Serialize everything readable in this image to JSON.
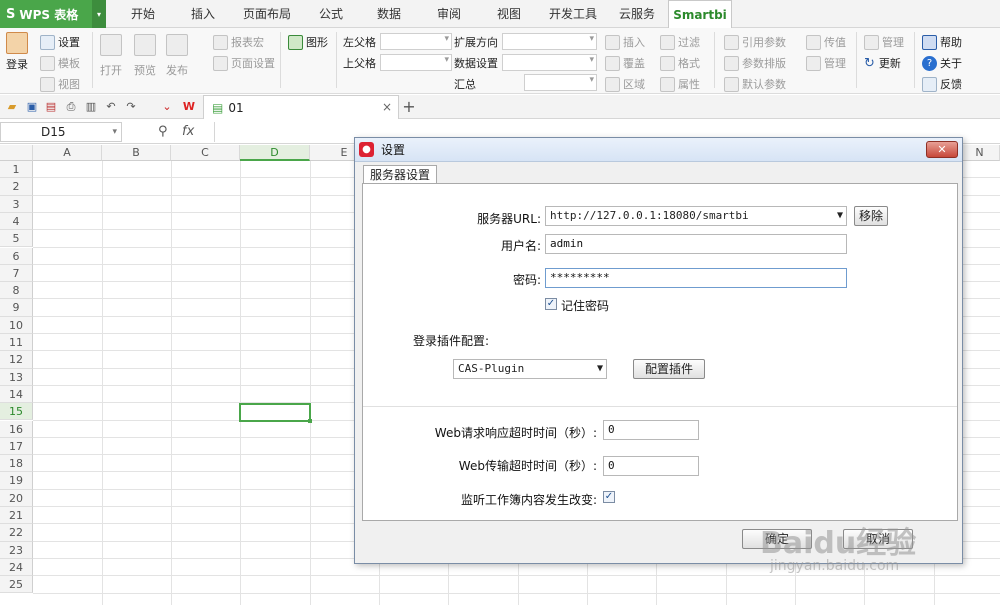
{
  "app": {
    "name": "WPS 表格"
  },
  "menu_tabs": [
    "开始",
    "插入",
    "页面布局",
    "公式",
    "数据",
    "审阅",
    "视图",
    "开发工具",
    "云服务",
    "Smartbi"
  ],
  "ribbon": {
    "login": "登录",
    "settings": "设置",
    "template": "模板",
    "view": "视图",
    "open": "打开",
    "preview": "预览",
    "publish": "发布",
    "report_macro": "报表宏",
    "page_setup": "页面设置",
    "chart": "图形",
    "left_parent": "左父格",
    "top_parent": "上父格",
    "expand_dir": "扩展方向",
    "data_setting": "数据设置",
    "summary": "汇总",
    "insert": "插入",
    "cover": "覆盖",
    "area": "区域",
    "filter": "过滤",
    "format": "格式",
    "property": "属性",
    "ref_param": "引用参数",
    "param_layout": "参数排版",
    "default_param": "默认参数",
    "pass_value": "传值",
    "manage": "管理",
    "manage2": "管理",
    "update": "更新",
    "help": "帮助",
    "about": "关于",
    "feedback": "反馈"
  },
  "doc_tab": {
    "name": "01"
  },
  "formula_bar": {
    "cell_ref": "D15",
    "fx": "fx"
  },
  "sheet": {
    "columns": [
      "A",
      "B",
      "C",
      "D",
      "E",
      "N"
    ],
    "rows": [
      "1",
      "2",
      "3",
      "4",
      "5",
      "6",
      "7",
      "8",
      "9",
      "10",
      "11",
      "12",
      "13",
      "14",
      "15",
      "16",
      "17",
      "18",
      "19",
      "20",
      "21",
      "22",
      "23",
      "24",
      "25"
    ],
    "selected_col": "D",
    "selected_row": "15"
  },
  "dialog": {
    "title": "设置",
    "tab": "服务器设置",
    "server_url_label": "服务器URL:",
    "server_url_value": "http://127.0.0.1:18080/smartbi",
    "remove_button": "移除",
    "username_label": "用户名:",
    "username_value": "admin",
    "password_label": "密码:",
    "password_value": "*********",
    "remember_label": "记住密码",
    "plugin_label": "登录插件配置:",
    "plugin_value": "CAS-Plugin",
    "config_plugin_button": "配置插件",
    "web_timeout_label": "Web请求响应超时时间（秒）:",
    "web_timeout_value": "0",
    "transfer_timeout_label": "Web传输超时时间（秒）:",
    "transfer_timeout_value": "0",
    "monitor_label": "监听工作簿内容发生改变:",
    "ok_button": "确定",
    "cancel_button": "取消"
  },
  "watermark": {
    "main": "Baidu经验",
    "sub": "jingyan.baidu.com"
  }
}
